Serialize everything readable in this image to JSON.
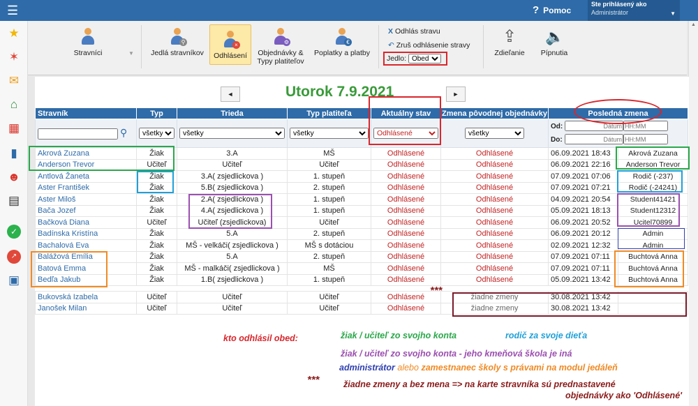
{
  "header": {
    "menu_icon": "hamburger-icon",
    "help_label": "Pomoc",
    "help_icon": "question-icon",
    "user_label": "Ste prihlásený ako",
    "user_name": "Administrátor"
  },
  "sidebar": {
    "icons": [
      "star-icon",
      "wand-icon",
      "mail-icon",
      "home-icon",
      "calendar-grid-icon",
      "book-icon",
      "person-icon",
      "calendar-icon",
      "check-icon",
      "chart-icon",
      "briefcase-icon"
    ]
  },
  "toolbar": {
    "items": [
      "Stravníci",
      "Jedlá stravníkov",
      "Odhlásení",
      "Objednávky &",
      "Typy platiteľov",
      "Poplatky a platby",
      "Zdieľanie",
      "Pípnutia"
    ],
    "odhlas": "Odhlás stravu",
    "zrus": "Zruš odhlásenie stravy",
    "jedlo_label": "Jedlo:",
    "jedlo_value": "Obed"
  },
  "page": {
    "date": "Utorok 7.9.2021",
    "prev": "◄",
    "next": "►"
  },
  "table": {
    "headers": [
      "Stravník",
      "Typ",
      "Trieda",
      "Typ platiteľa",
      "Aktuálny stav",
      "Zmena pôvodnej objednávky",
      "Posledná zmena"
    ],
    "filters": {
      "typ": "všetky",
      "trieda": "všetky",
      "platitel": "všetky",
      "stav": "Odhlásené",
      "zmena": "všetky",
      "od": "Od:",
      "do": "Do:",
      "datum": "Dátum",
      "time": "HH:MM"
    },
    "rows": [
      [
        "Akrová Zuzana",
        "Žiak",
        "3.A",
        "MŠ",
        "Odhlásené",
        "Odhlásené",
        "06.09.2021 18:43",
        "Akrová Zuzana"
      ],
      [
        "Anderson Trevor",
        "Učiteľ",
        "Učiteľ",
        "Učiteľ",
        "Odhlásené",
        "Odhlásené",
        "06.09.2021 22:16",
        "Anderson Trevor"
      ],
      [
        "Antlová Žaneta",
        "Žiak",
        "3.A( zsjedlickova )",
        "1. stupeň",
        "Odhlásené",
        "Odhlásené",
        "07.09.2021 07:06",
        "Rodič (-237)"
      ],
      [
        "Aster František",
        "Žiak",
        "5.B( zsjedlickova )",
        "2. stupeň",
        "Odhlásené",
        "Odhlásené",
        "07.09.2021 07:21",
        "Rodič (-24241)"
      ],
      [
        "Aster Miloš",
        "Žiak",
        "2.A( zsjedlickova )",
        "1. stupeň",
        "Odhlásené",
        "Odhlásené",
        "04.09.2021 20:54",
        "Student41421"
      ],
      [
        "Bača Jozef",
        "Žiak",
        "4.A( zsjedlickova )",
        "1. stupeň",
        "Odhlásené",
        "Odhlásené",
        "05.09.2021 18:13",
        "Student12312"
      ],
      [
        "Bačková Diana",
        "Učiteľ",
        "Učiteľ (zsjedlickova)",
        "Učiteľ",
        "Odhlásené",
        "Odhlásené",
        "06.09.2021 20:52",
        "Ucitel70899"
      ],
      [
        "Badínska Kristína",
        "Žiak",
        "5.A",
        "2. stupeň",
        "Odhlásené",
        "Odhlásené",
        "06.09.2021 20:12",
        "Admin"
      ],
      [
        "Bachalová Eva",
        "Žiak",
        "MŠ - velkáči( zsjedlickova )",
        "MŠ s dotáciou",
        "Odhlásené",
        "Odhlásené",
        "02.09.2021 12:32",
        "Admin"
      ],
      [
        "Balážová Emília",
        "Žiak",
        "5.A",
        "2. stupeň",
        "Odhlásené",
        "Odhlásené",
        "07.09.2021 07:11",
        "Buchtová Anna"
      ],
      [
        "Batová Emma",
        "Žiak",
        "MŠ - malkáči( zsjedlickova )",
        "MŠ",
        "Odhlásené",
        "Odhlásené",
        "07.09.2021 07:11",
        "Buchtová Anna"
      ],
      [
        "Bedľa Jakub",
        "Žiak",
        "1.B( zsjedlickova )",
        "1. stupeň",
        "Odhlásené",
        "Odhlásené",
        "05.09.2021 13:42",
        "Buchtová Anna"
      ]
    ],
    "rows2": [
      [
        "Bukovská Izabela",
        "Učiteľ",
        "Učiteľ",
        "Učiteľ",
        "Odhlásené",
        "žiadne zmeny",
        "30.08.2021 13:42",
        ""
      ],
      [
        "Janošek Milan",
        "Učiteľ",
        "Učiteľ",
        "Učiteľ",
        "Odhlásené",
        "žiadne zmeny",
        "30.08.2021 13:42",
        ""
      ]
    ]
  },
  "notes": {
    "stars": "***",
    "who": "kto odhlásil obed:",
    "green": "žiak / učiteľ zo svojho konta",
    "blue": "rodič za svoje dieťa",
    "purple": "žiak / učiteľ zo svojho konta - jeho kmeňová škola je iná",
    "admin": "administrátor",
    "or": "alebo",
    "orange": "zamestnanec školy s právami na modul jedáleň",
    "stars2": "***",
    "last1": "žiadne zmeny a bez mena => na karte stravníka sú prednastavené",
    "last2": "objednávky ako 'Odhlásené'"
  },
  "colors": {
    "header": "#2e6ba8",
    "green": "#2aa84a",
    "blue": "#1fa0d8",
    "purple": "#9b4fb0",
    "orange": "#f08a24",
    "maroon": "#7a1a2a",
    "red": "#d9262c"
  }
}
